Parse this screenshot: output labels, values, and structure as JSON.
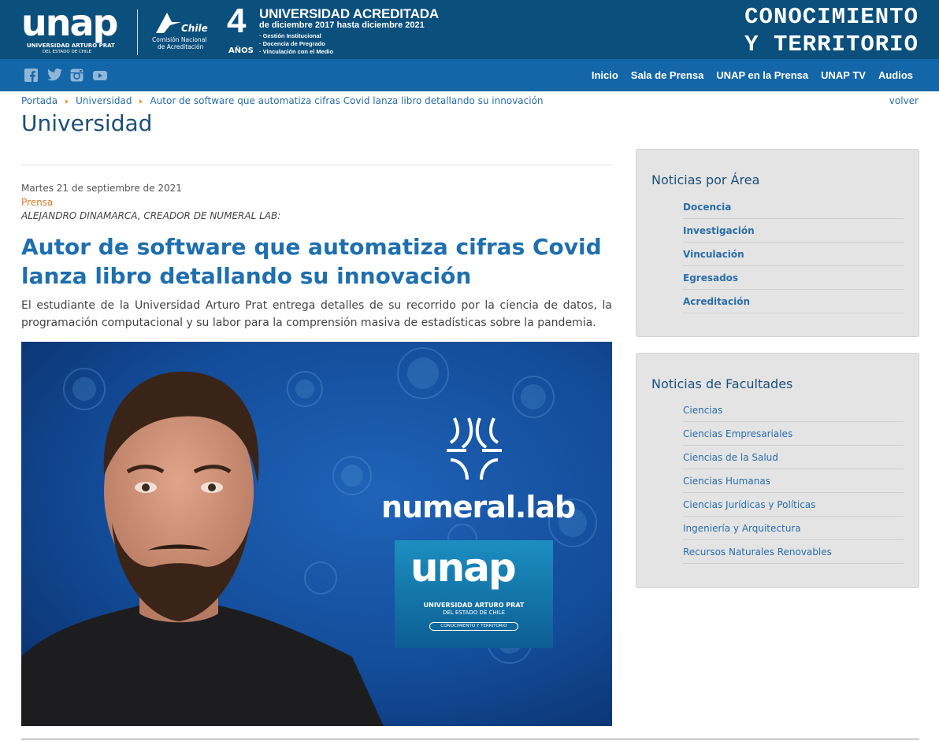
{
  "header": {
    "logo_word": "unap",
    "logo_sub1": "UNIVERSIDAD ARTURO PRAT",
    "logo_sub2": "DEL ESTADO DE CHILE",
    "cna_chile": "Chile",
    "cna_line1": "Comisión Nacional",
    "cna_line2": "de Acreditación",
    "acred_years": "4",
    "acred_years_label": "AÑOS",
    "acred_title": "UNIVERSIDAD ACREDITADA",
    "acred_dates": "de diciembre 2017 hasta diciembre 2021",
    "acred_items": [
      "· Gestión Institucional",
      "· Docencia de Pregrado",
      "· Vinculación con el Medio"
    ],
    "tagline_line1": "CONOCIMIENTO",
    "tagline_line2": "Y TERRITORIO"
  },
  "nav": {
    "social_icons": [
      "facebook-icon",
      "twitter-icon",
      "instagram-icon",
      "youtube-icon"
    ],
    "links": [
      "Inicio",
      "Sala de Prensa",
      "UNAP en la Prensa",
      "UNAP TV",
      "Audios"
    ]
  },
  "breadcrumb": {
    "items": [
      "Portada",
      "Universidad",
      "Autor de software que automatiza cifras Covid lanza libro detallando su innovación"
    ],
    "back": "volver"
  },
  "section_title": "Universidad",
  "article": {
    "date": "Martes 21 de septiembre de 2021",
    "category": "Prensa",
    "kicker": "ALEJANDRO DINAMARCA, CREADOR DE NUMERAL LAB:",
    "title": "Autor de software que automatiza cifras Covid lanza libro detallando su innovación",
    "lead": "El estudiante de la Universidad Arturo Prat entrega detalles de su recorrido por la ciencia de datos, la programación computacional y su labor para la comprensión masiva de estadísticas sobre la pandemia.",
    "image": {
      "brand_text": "numeral.lab",
      "logo_word": "unap",
      "logo_sub1": "UNIVERSIDAD ARTURO PRAT",
      "logo_sub2": "DEL ESTADO DE CHILE",
      "logo_tag": "CONOCIMIENTO Y TERRITORIO"
    }
  },
  "sidebar": {
    "areas": {
      "title": "Noticias por Área",
      "items": [
        "Docencia",
        "Investigación",
        "Vinculación",
        "Egresados",
        "Acreditación"
      ]
    },
    "faculties": {
      "title": "Noticias de Facultades",
      "items": [
        "Ciencias",
        "Ciencias Empresariales",
        "Ciencias de la Salud",
        "Ciencias Humanas",
        "Ciencias Jurídicas y Políticas",
        "Ingeniería y Arquitectura",
        "Recursos Naturales Renovables"
      ]
    }
  },
  "colors": {
    "header_bg": "#0b4f7c",
    "nav_bg": "#1366a8",
    "link": "#2a6da8",
    "title_blue": "#1e6faf",
    "category_orange": "#e07b2b",
    "sidebar_bg": "#e4e4e4"
  }
}
